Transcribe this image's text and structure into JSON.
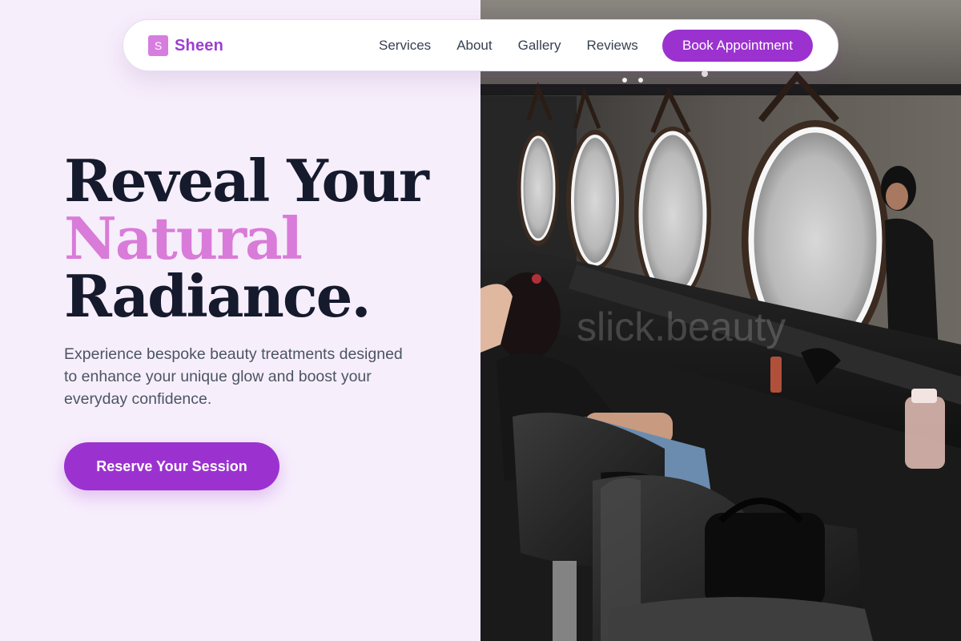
{
  "brand": {
    "logo_letter": "S",
    "name": "Sheen"
  },
  "nav": {
    "links": [
      "Services",
      "About",
      "Gallery",
      "Reviews"
    ],
    "cta_label": "Book Appointment"
  },
  "hero": {
    "title_line1": "Reveal Your",
    "title_line2": "Natural",
    "title_line3": "Radiance.",
    "description": "Experience bespoke beauty treatments designed to enhance your unique glow and boost your everyday confidence.",
    "cta_label": "Reserve Your Session"
  },
  "image": {
    "watermark": "slick.beauty"
  },
  "colors": {
    "accent": "#9b32cf",
    "accent_light": "#d97bd9",
    "heading": "#151a2c",
    "background": "#f7eefc"
  }
}
